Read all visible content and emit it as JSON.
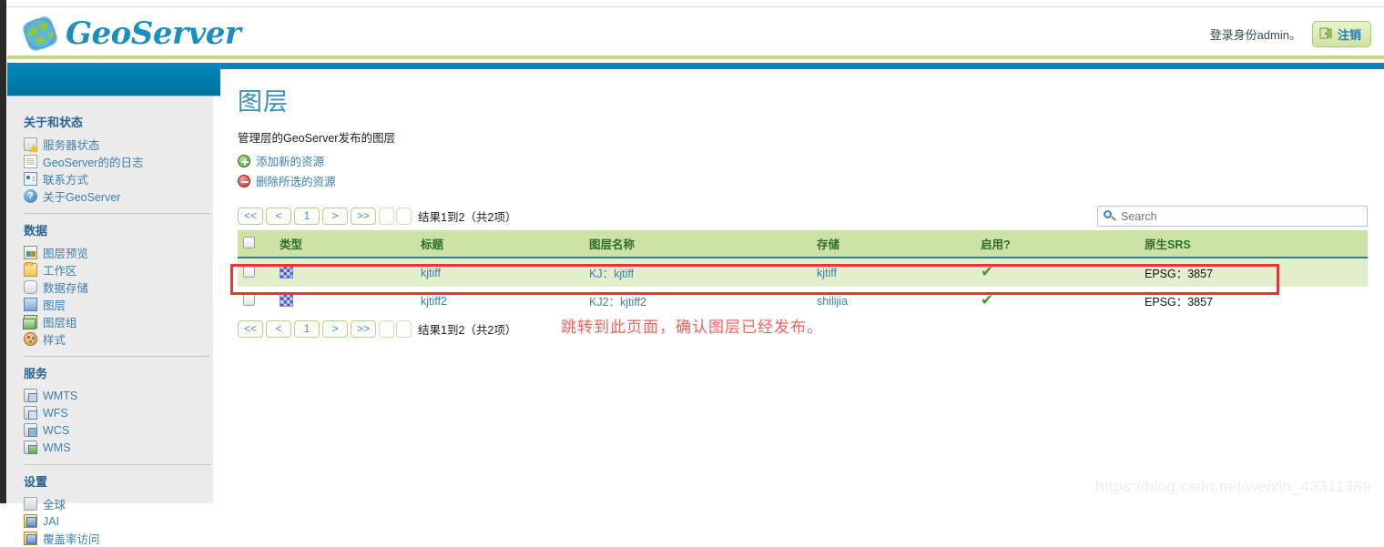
{
  "header": {
    "brand": "GeoServer",
    "login_text": "登录身份admin。",
    "logout_label": "注销"
  },
  "sidebar": {
    "sections": [
      {
        "title": "关于和状态",
        "items": [
          {
            "label": "服务器状态",
            "icon": "server-status-icon"
          },
          {
            "label": "GeoServer的的日志",
            "icon": "document-icon"
          },
          {
            "label": "联系方式",
            "icon": "contact-card-icon"
          },
          {
            "label": "关于GeoServer",
            "icon": "about-info-icon"
          }
        ]
      },
      {
        "title": "数据",
        "items": [
          {
            "label": "图层预览",
            "icon": "layer-preview-icon"
          },
          {
            "label": "工作区",
            "icon": "folder-icon"
          },
          {
            "label": "数据存储",
            "icon": "datastore-icon"
          },
          {
            "label": "图层",
            "icon": "layer-icon"
          },
          {
            "label": "图层组",
            "icon": "layer-group-icon"
          },
          {
            "label": "样式",
            "icon": "palette-icon"
          }
        ]
      },
      {
        "title": "服务",
        "items": [
          {
            "label": "WMTS",
            "icon": "service-wmts-icon"
          },
          {
            "label": "WFS",
            "icon": "service-wfs-icon"
          },
          {
            "label": "WCS",
            "icon": "service-wcs-icon"
          },
          {
            "label": "WMS",
            "icon": "service-wms-icon"
          }
        ]
      },
      {
        "title": "设置",
        "items": [
          {
            "label": "全球",
            "icon": "global-settings-icon"
          },
          {
            "label": "JAI",
            "icon": "jai-icon"
          },
          {
            "label": "覆盖率访问",
            "icon": "coverage-access-icon"
          }
        ]
      }
    ]
  },
  "main": {
    "title": "图层",
    "description": "管理层的GeoServer发布的图层",
    "actions": [
      {
        "label": "添加新的资源",
        "icon": "add-icon"
      },
      {
        "label": "删除所选的资源",
        "icon": "remove-icon"
      }
    ],
    "pagination": {
      "first": "<<",
      "prev": "<",
      "page": "1",
      "next": ">",
      "last": ">>",
      "summary": "结果1到2（共2项）"
    },
    "search": {
      "placeholder": "Search",
      "value": "",
      "icon": "search-icon"
    },
    "table": {
      "columns": [
        "类型",
        "标题",
        "图层名称",
        "存储",
        "启用?",
        "原生SRS"
      ],
      "rows": [
        {
          "selected": false,
          "type_icon": "raster-layer-icon",
          "title": "kjtiff",
          "layer_name": "KJ：kjtiff",
          "store": "kjtiff",
          "enabled": "✔",
          "native_srs": "EPSG：3857"
        },
        {
          "selected": false,
          "type_icon": "raster-layer-icon",
          "title": "kjtiff2",
          "layer_name": "KJ2：kjtiff2",
          "store": "shilijia",
          "enabled": "✔",
          "native_srs": "EPSG：3857"
        }
      ]
    },
    "annotation": "跳转到此页面，确认图层已经发布。"
  },
  "watermark": "https://blog.csdn.net/weixin_43311389",
  "colors": {
    "brand_blue": "#1a90c0",
    "banner_blue": "#00739e",
    "header_rule_green": "#c3d68a",
    "table_header_green": "#cde3a3",
    "row_alt_green": "#e3eecc",
    "link_blue": "#3a7fb0",
    "annotation_red": "#f4625c",
    "highlight_red": "#f0332f",
    "check_green": "#4a9b34"
  }
}
